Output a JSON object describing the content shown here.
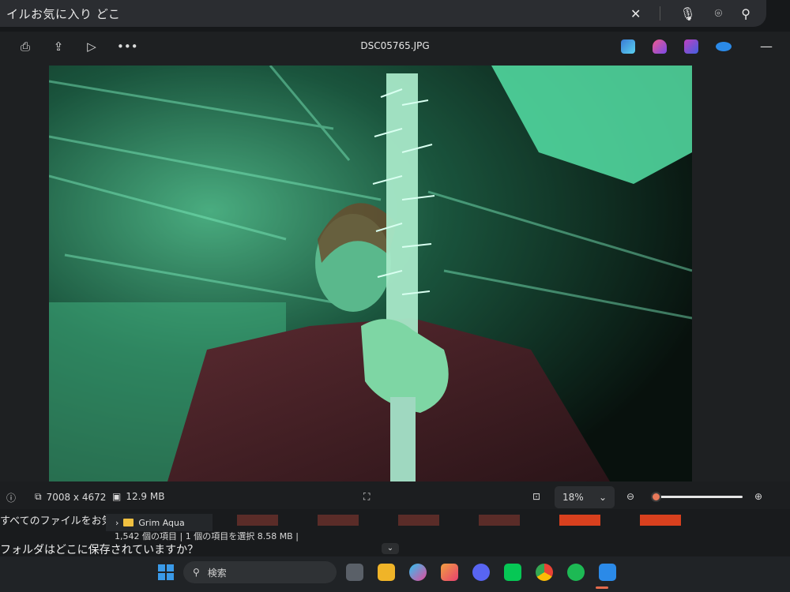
{
  "search_bar": {
    "query": "イルお気に入り どこ"
  },
  "viewer": {
    "filename": "DSC05765.JPG",
    "status": {
      "dimensions": "7008 x 4672",
      "filesize": "12.9 MB",
      "zoom": "18%",
      "zoom_level": 0.0
    }
  },
  "explorer": {
    "background_text_1": "すべてのファイルをお気に",
    "folder_name": "Grim Aqua",
    "item_count": "1,542 個の項目",
    "selection": "1 個の項目を選択",
    "selection_size": "8.58 MB",
    "background_text_2": "フォルダはどこに保存されていますか？"
  },
  "taskbar": {
    "search_placeholder": "検索"
  },
  "colors": {
    "accent": "#e8795a",
    "photo_tint": "#3fbf8c"
  }
}
